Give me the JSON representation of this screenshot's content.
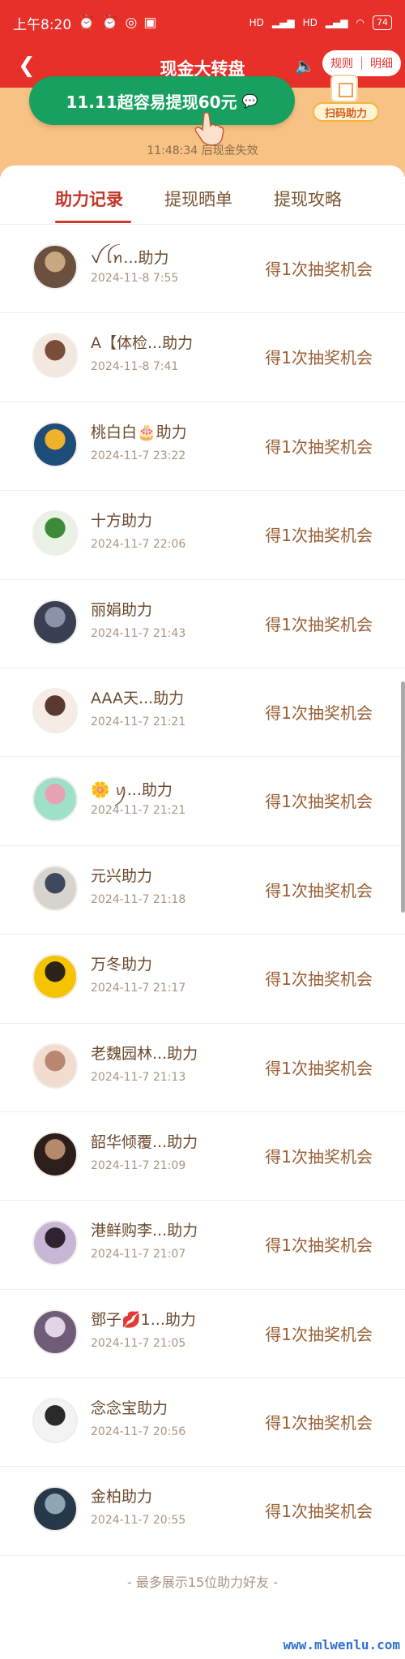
{
  "status_bar": {
    "time": "上午8:20",
    "net_labels": [
      "HD",
      "HD"
    ],
    "battery": "74"
  },
  "nav": {
    "title": "现金大转盘",
    "rules_label": "规则",
    "detail_label": "明细"
  },
  "banner": {
    "cash_button_label": "11.11超容易提现60元",
    "scan_label": "扫码助力",
    "timer_text": "11:48:34 后现金失效"
  },
  "tabs": [
    "助力记录",
    "提现晒单",
    "提现攻略"
  ],
  "records": [
    {
      "name": "ꪜ ꪶꪀ...助力",
      "date": "2024-11-8 7:55",
      "reward": "得1次抽奖机会"
    },
    {
      "name": "A【体检...助力",
      "date": "2024-11-8 7:41",
      "reward": "得1次抽奖机会"
    },
    {
      "name": "桃白白🎂助力",
      "date": "2024-11-7 23:22",
      "reward": "得1次抽奖机会"
    },
    {
      "name": "十方助力",
      "date": "2024-11-7 22:06",
      "reward": "得1次抽奖机会"
    },
    {
      "name": "丽娟助力",
      "date": "2024-11-7 21:43",
      "reward": "得1次抽奖机会"
    },
    {
      "name": "AAA天...助力",
      "date": "2024-11-7 21:21",
      "reward": "得1次抽奖机会"
    },
    {
      "name": "🌼 ꪗ...助力",
      "date": "2024-11-7 21:21",
      "reward": "得1次抽奖机会"
    },
    {
      "name": "元兴助力",
      "date": "2024-11-7 21:18",
      "reward": "得1次抽奖机会"
    },
    {
      "name": "万冬助力",
      "date": "2024-11-7 21:17",
      "reward": "得1次抽奖机会"
    },
    {
      "name": "老魏园林...助力",
      "date": "2024-11-7 21:13",
      "reward": "得1次抽奖机会"
    },
    {
      "name": "韶华倾覆...助力",
      "date": "2024-11-7 21:09",
      "reward": "得1次抽奖机会"
    },
    {
      "name": "港鲜购李...助力",
      "date": "2024-11-7 21:07",
      "reward": "得1次抽奖机会"
    },
    {
      "name": "鄧子💋1...助力",
      "date": "2024-11-7 21:05",
      "reward": "得1次抽奖机会"
    },
    {
      "name": "念念宝助力",
      "date": "2024-11-7 20:56",
      "reward": "得1次抽奖机会"
    },
    {
      "name": "金柏助力",
      "date": "2024-11-7 20:55",
      "reward": "得1次抽奖机会"
    }
  ],
  "footer_text": "- 最多展示15位助力好友 -",
  "watermark": "www.mlwenlu.com",
  "colors": {
    "brand_red": "#e8302a",
    "cash_green": "#17a05f",
    "reward_brown": "#9a5f35"
  }
}
